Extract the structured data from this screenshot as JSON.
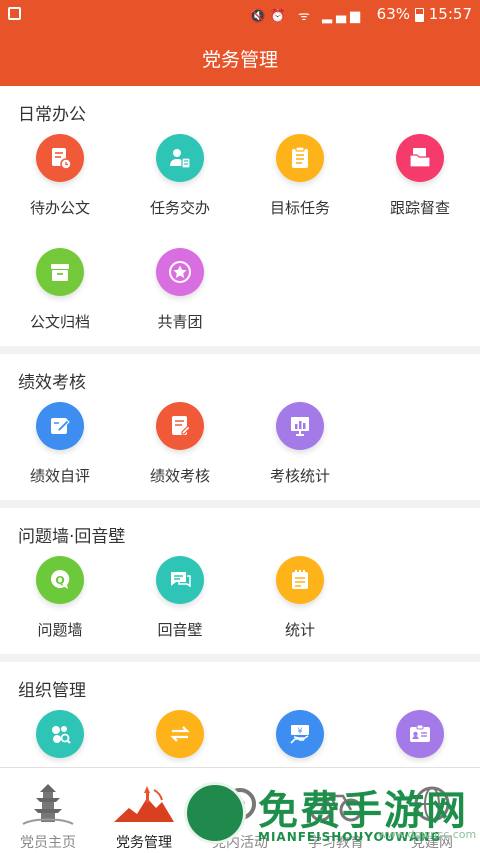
{
  "status_bar": {
    "battery": "63%",
    "time": "15:57",
    "network": "4G"
  },
  "header": {
    "title": "党务管理"
  },
  "sections": [
    {
      "title": "日常办公",
      "items": [
        {
          "label": "待办公文",
          "icon": "pending-document-icon",
          "color": "#f15a38"
        },
        {
          "label": "任务交办",
          "icon": "task-assign-icon",
          "color": "#2ec4b6"
        },
        {
          "label": "目标任务",
          "icon": "clipboard-icon",
          "color": "#ffb31a"
        },
        {
          "label": "跟踪督查",
          "icon": "folder-icon",
          "color": "#f43b6b"
        },
        {
          "label": "公文归档",
          "icon": "archive-box-icon",
          "color": "#74c93a"
        },
        {
          "label": "共青团",
          "icon": "star-badge-icon",
          "color": "#d86ee0"
        }
      ]
    },
    {
      "title": "绩效考核",
      "items": [
        {
          "label": "绩效自评",
          "icon": "edit-icon",
          "color": "#3d8ef0"
        },
        {
          "label": "绩效考核",
          "icon": "review-document-icon",
          "color": "#f15a38"
        },
        {
          "label": "考核统计",
          "icon": "bar-chart-icon",
          "color": "#a47ae8"
        }
      ]
    },
    {
      "title": "问题墙·回音壁",
      "items": [
        {
          "label": "问题墙",
          "icon": "question-bubble-icon",
          "color": "#6cc93b"
        },
        {
          "label": "回音壁",
          "icon": "chat-bubble-icon",
          "color": "#2ec4b6"
        },
        {
          "label": "统计",
          "icon": "notepad-icon",
          "color": "#ffb31a"
        }
      ]
    },
    {
      "title": "组织管理",
      "items": [
        {
          "label": "",
          "icon": "org-search-icon",
          "color": "#2ec4b6"
        },
        {
          "label": "",
          "icon": "transfer-arrows-icon",
          "color": "#ffb31a"
        },
        {
          "label": "",
          "icon": "dues-payment-icon",
          "color": "#3d8ef0"
        },
        {
          "label": "",
          "icon": "id-card-icon",
          "color": "#a47ae8"
        }
      ]
    }
  ],
  "tabs": [
    {
      "label": "党员主页",
      "icon": "pagoda-icon",
      "active": false
    },
    {
      "label": "党务管理",
      "icon": "red-landmark-icon",
      "active": true
    },
    {
      "label": "党内活动",
      "icon": "gear-activity-icon",
      "active": false
    },
    {
      "label": "学习教育",
      "icon": "bicycle-icon",
      "active": false
    },
    {
      "label": "党建网",
      "icon": "globe-icon",
      "active": false
    }
  ],
  "watermark": {
    "title": "免费手游网",
    "subtitle": "MIANFEISHOUYOUWANG",
    "url": "www.downcc.com"
  }
}
